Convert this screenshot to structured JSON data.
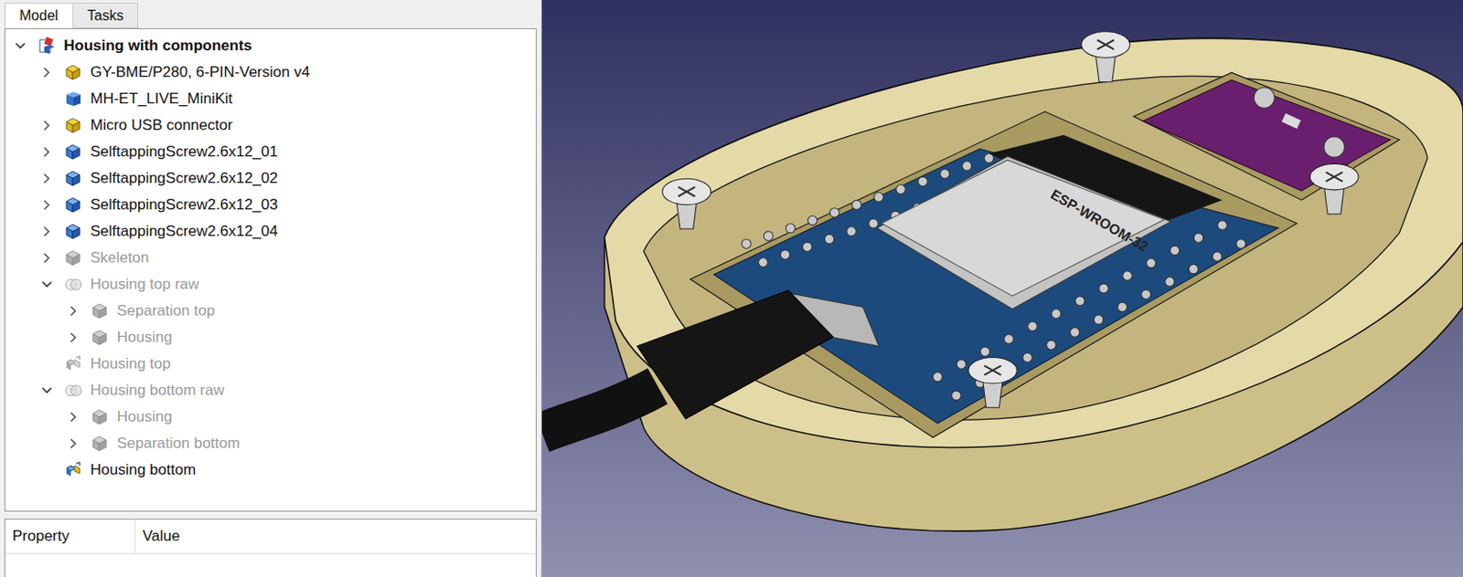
{
  "window": {
    "title": "Housing with components"
  },
  "tabs": [
    {
      "label": "Model",
      "selected": true
    },
    {
      "label": "Tasks",
      "selected": false
    }
  ],
  "tree": [
    {
      "label": "Housing with components",
      "level": 0,
      "expandable": true,
      "expanded": true,
      "greyed": false,
      "bold": true,
      "icon": "document"
    },
    {
      "label": "GY-BME/P280, 6-PIN-Version v4",
      "level": 1,
      "expandable": true,
      "expanded": false,
      "greyed": false,
      "bold": false,
      "icon": "part"
    },
    {
      "label": "MH-ET_LIVE_MiniKit",
      "level": 1,
      "expandable": false,
      "expanded": false,
      "greyed": false,
      "bold": false,
      "icon": "cube"
    },
    {
      "label": "Micro USB connector",
      "level": 1,
      "expandable": true,
      "expanded": false,
      "greyed": false,
      "bold": false,
      "icon": "part"
    },
    {
      "label": "SelftappingScrew2.6x12_01",
      "level": 1,
      "expandable": true,
      "expanded": false,
      "greyed": false,
      "bold": false,
      "icon": "body"
    },
    {
      "label": "SelftappingScrew2.6x12_02",
      "level": 1,
      "expandable": true,
      "expanded": false,
      "greyed": false,
      "bold": false,
      "icon": "body"
    },
    {
      "label": "SelftappingScrew2.6x12_03",
      "level": 1,
      "expandable": true,
      "expanded": false,
      "greyed": false,
      "bold": false,
      "icon": "body"
    },
    {
      "label": "SelftappingScrew2.6x12_04",
      "level": 1,
      "expandable": true,
      "expanded": false,
      "greyed": false,
      "bold": false,
      "icon": "body"
    },
    {
      "label": "Skeleton",
      "level": 1,
      "expandable": true,
      "expanded": false,
      "greyed": true,
      "bold": false,
      "icon": "body"
    },
    {
      "label": "Housing top raw",
      "level": 1,
      "expandable": true,
      "expanded": true,
      "greyed": true,
      "bold": false,
      "icon": "boolean"
    },
    {
      "label": "Separation top",
      "level": 2,
      "expandable": true,
      "expanded": false,
      "greyed": true,
      "bold": false,
      "icon": "body"
    },
    {
      "label": "Housing",
      "level": 2,
      "expandable": true,
      "expanded": false,
      "greyed": true,
      "bold": false,
      "icon": "body"
    },
    {
      "label": "Housing top",
      "level": 1,
      "expandable": false,
      "expanded": false,
      "greyed": true,
      "bold": false,
      "icon": "refine"
    },
    {
      "label": "Housing bottom raw",
      "level": 1,
      "expandable": true,
      "expanded": true,
      "greyed": true,
      "bold": false,
      "icon": "boolean"
    },
    {
      "label": "Housing",
      "level": 2,
      "expandable": true,
      "expanded": false,
      "greyed": true,
      "bold": false,
      "icon": "body"
    },
    {
      "label": "Separation bottom",
      "level": 2,
      "expandable": true,
      "expanded": false,
      "greyed": true,
      "bold": false,
      "icon": "body"
    },
    {
      "label": "Housing bottom",
      "level": 1,
      "expandable": false,
      "expanded": false,
      "greyed": false,
      "bold": false,
      "icon": "refine"
    }
  ],
  "properties": {
    "columns": [
      "Property",
      "Value"
    ]
  },
  "viewport": {
    "chip_label": "ESP-WROOM-32"
  }
}
